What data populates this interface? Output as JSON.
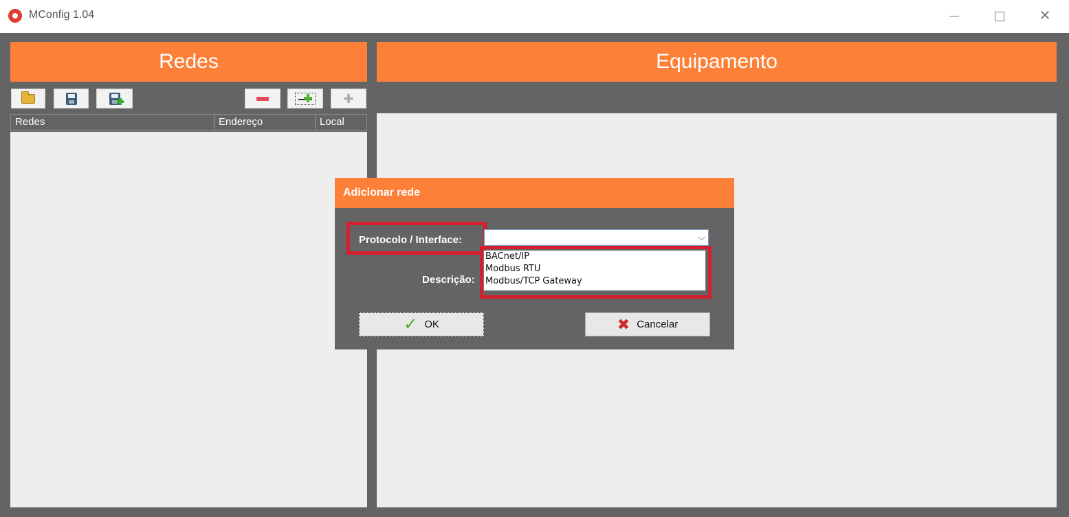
{
  "window": {
    "title": "MConfig 1.04"
  },
  "redes_panel": {
    "header": "Redes",
    "columns": [
      "Redes",
      "Endereço",
      "Local"
    ]
  },
  "equipamento_panel": {
    "header": "Equipamento"
  },
  "dialog": {
    "title": "Adicionar rede",
    "protocol_label": "Protocolo / Interface:",
    "description_label": "Descrição:",
    "protocol_value": "",
    "dropdown_options": [
      "BACnet/IP",
      "Modbus RTU",
      "Modbus/TCP Gateway"
    ],
    "ok_label": "OK",
    "cancel_label": "Cancelar"
  },
  "colors": {
    "accent": "#fd8039",
    "background": "#646464",
    "highlight": "#d61f2c"
  }
}
